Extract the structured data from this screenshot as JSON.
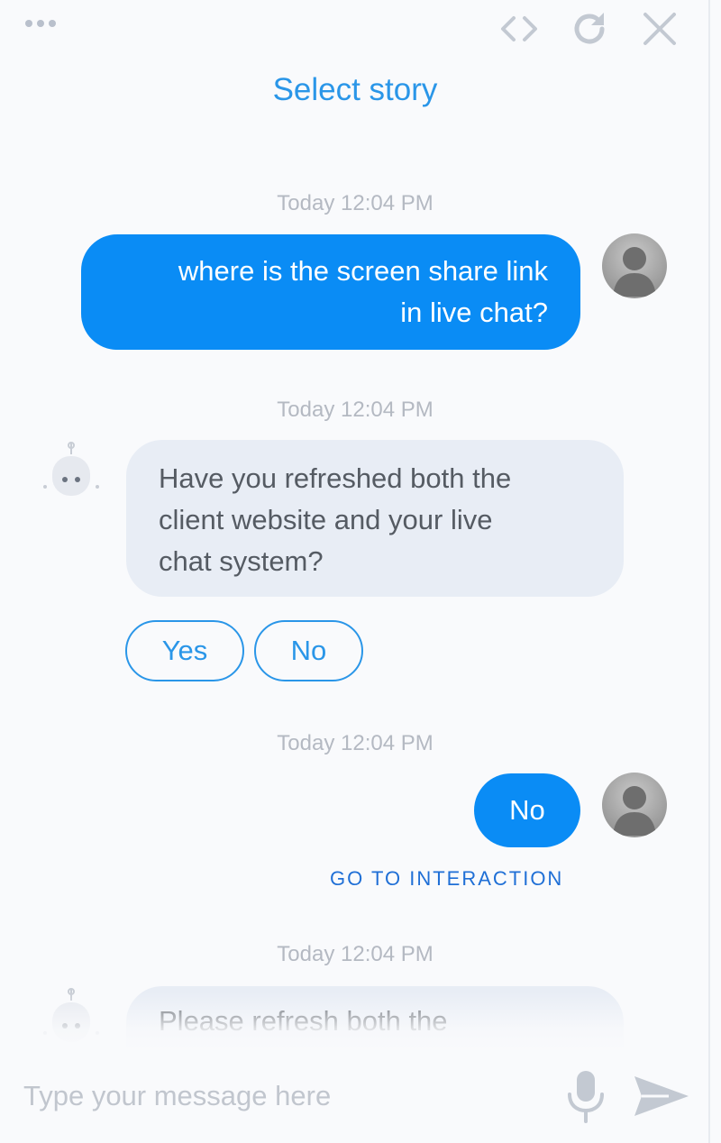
{
  "header": {
    "menu_icon": "more-dots-icon",
    "code_icon": "code-icon",
    "refresh_icon": "refresh-icon",
    "close_icon": "close-icon",
    "select_story": "Select story"
  },
  "messages": [
    {
      "sender": "user",
      "timestamp": "Today 12:04 PM",
      "line1": "where is the screen share link",
      "line2": "in live chat?"
    },
    {
      "sender": "bot",
      "timestamp": "Today 12:04 PM",
      "line1": "Have you refreshed both the",
      "line2": "client website and your live",
      "line3": "chat system?",
      "options": [
        "Yes",
        "No"
      ]
    },
    {
      "sender": "user",
      "timestamp": "Today 12:04 PM",
      "text": "No",
      "link": "GO TO INTERACTION"
    },
    {
      "sender": "bot",
      "timestamp": "Today 12:04 PM",
      "line1": "Please refresh both the"
    }
  ],
  "composer": {
    "placeholder": "Type your message here",
    "mic_icon": "microphone-icon",
    "send_icon": "send-icon"
  },
  "colors": {
    "accent": "#2a96e8",
    "user_bubble": "#0a8cf5",
    "bot_bubble": "#e8edf5",
    "timestamp": "#b4b9c2",
    "link": "#1f6fd6"
  }
}
